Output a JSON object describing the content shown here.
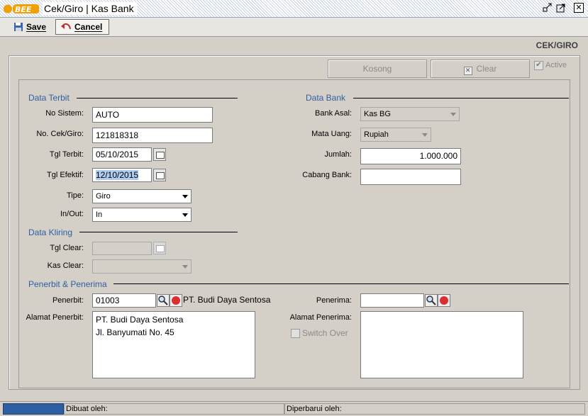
{
  "window": {
    "logo_text": "BEE",
    "title": "Cek/Giro | Kas Bank"
  },
  "toolbar": {
    "save_label": "Save",
    "cancel_label": "Cancel"
  },
  "form_title": "CEK/GIRO",
  "actions": {
    "kosong_label": "Kosong",
    "clear_label": "Clear",
    "active_label": "Active",
    "active_checked": true
  },
  "data_terbit": {
    "title": "Data Terbit",
    "no_sistem_label": "No Sistem:",
    "no_sistem_value": "AUTO",
    "no_cek_label": "No. Cek/Giro:",
    "no_cek_value": "121818318",
    "tgl_terbit_label": "Tgl Terbit:",
    "tgl_terbit_value": "05/10/2015",
    "tgl_efektif_label": "Tgl Efektif:",
    "tgl_efektif_value": "12/10/2015",
    "tipe_label": "Tipe:",
    "tipe_value": "Giro",
    "inout_label": "In/Out:",
    "inout_value": "In"
  },
  "data_bank": {
    "title": "Data Bank",
    "bank_asal_label": "Bank Asal:",
    "bank_asal_value": "Kas BG",
    "mata_uang_label": "Mata Uang:",
    "mata_uang_value": "Rupiah",
    "jumlah_label": "Jumlah:",
    "jumlah_value": "1.000.000",
    "cabang_label": "Cabang Bank:",
    "cabang_value": ""
  },
  "data_kliring": {
    "title": "Data Kliring",
    "tgl_clear_label": "Tgl Clear:",
    "tgl_clear_value": "",
    "kas_clear_label": "Kas Clear:",
    "kas_clear_value": ""
  },
  "penerbit_penerima": {
    "title": "Penerbit & Penerima",
    "penerbit_label": "Penerbit:",
    "penerbit_code": "01003",
    "penerbit_name": "PT. Budi Daya Sentosa",
    "alamat_penerbit_label": "Alamat Penerbit:",
    "alamat_penerbit_lines": [
      "PT. Budi Daya Sentosa",
      "Jl. Banyumati No. 45"
    ],
    "penerima_label": "Penerima:",
    "penerima_code": "",
    "alamat_penerima_label": "Alamat Penerima:",
    "switch_over_label": "Switch Over",
    "switch_over_checked": false
  },
  "statusbar": {
    "dibuat_label": "Dibuat oleh:",
    "diperbarui_label": "Diperbarui oleh:"
  }
}
